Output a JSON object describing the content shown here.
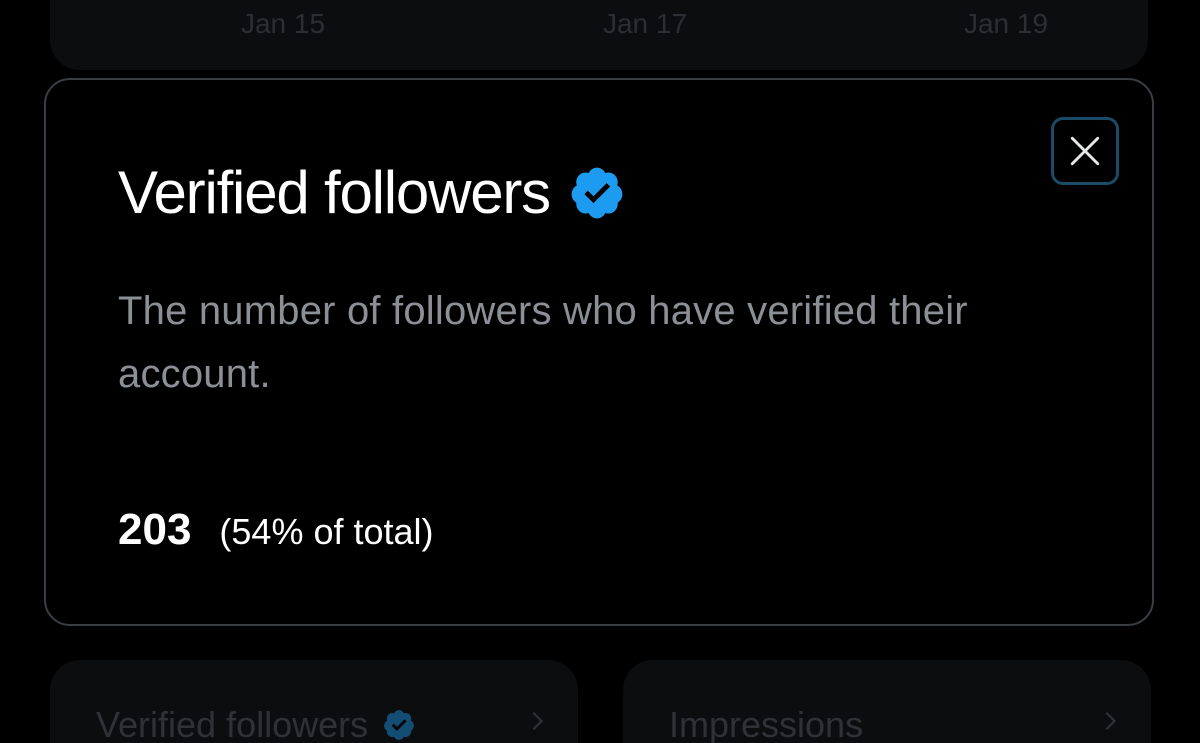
{
  "chart_axis": {
    "labels": [
      "Jan 15",
      "Jan 17",
      "Jan 19"
    ]
  },
  "modal": {
    "title": "Verified followers",
    "description": "The number of followers who have verified their account.",
    "stat_value": "203",
    "stat_percent": "(54% of total)",
    "badge_icon": "verified-badge-icon",
    "close_icon": "close-icon"
  },
  "tiles": [
    {
      "title": "Verified followers",
      "has_badge": true
    },
    {
      "title": "Impressions",
      "has_badge": false
    }
  ],
  "colors": {
    "background": "#000000",
    "badge_blue": "#1d9bf0",
    "close_border": "#1b4b67",
    "description": "#8b9096"
  }
}
